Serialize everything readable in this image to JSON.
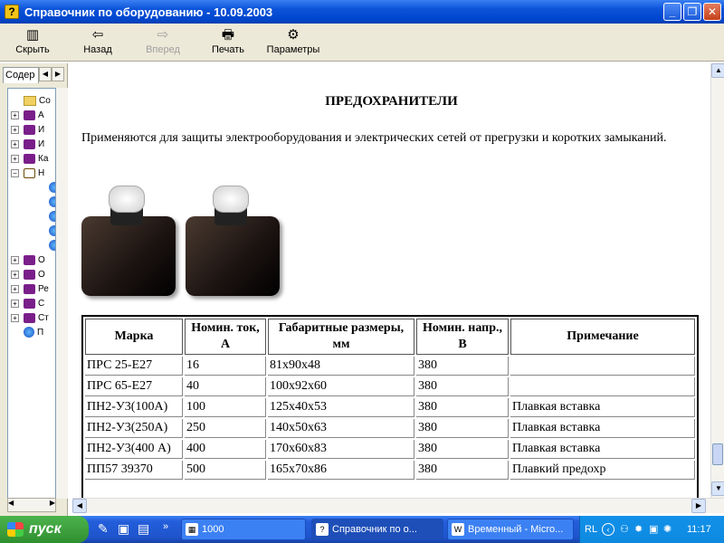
{
  "window": {
    "title": "Справочник по оборудованию - 10.09.2003",
    "app_icon": "?",
    "btn_min": "_",
    "btn_max": "❐",
    "btn_close": "✕"
  },
  "toolbar": {
    "hide": {
      "label": "Скрыть",
      "icon": "▥"
    },
    "back": {
      "label": "Назад",
      "icon": "⇦"
    },
    "forward": {
      "label": "Вперед",
      "icon": "⇨"
    },
    "print": {
      "label": "Печать",
      "icon": "🖶"
    },
    "options": {
      "label": "Параметры",
      "icon": "⚙"
    }
  },
  "sidebar": {
    "tab_label": "Содер",
    "items": [
      {
        "label": "Со",
        "icon": "folder-icon",
        "expander": "",
        "top": 0
      },
      {
        "label": "А",
        "icon": "book-icon",
        "expander": "+"
      },
      {
        "label": "И",
        "icon": "book-icon",
        "expander": "+"
      },
      {
        "label": "И",
        "icon": "book-icon",
        "expander": "+"
      },
      {
        "label": "Ка",
        "icon": "book-icon",
        "expander": "+"
      },
      {
        "label": "Н",
        "icon": "open-book-icon",
        "expander": "−"
      },
      {
        "label": "",
        "icon": "page-icon",
        "expander": ""
      },
      {
        "label": "",
        "icon": "page-icon",
        "expander": ""
      },
      {
        "label": "",
        "icon": "page-icon",
        "expander": ""
      },
      {
        "label": "",
        "icon": "page-icon",
        "expander": ""
      },
      {
        "label": "",
        "icon": "page-icon",
        "expander": ""
      },
      {
        "label": "О",
        "icon": "book-icon",
        "expander": "+"
      },
      {
        "label": "О",
        "icon": "book-icon",
        "expander": "+"
      },
      {
        "label": "Ре",
        "icon": "book-icon",
        "expander": "+"
      },
      {
        "label": "С",
        "icon": "book-icon",
        "expander": "+"
      },
      {
        "label": "Ст",
        "icon": "book-icon",
        "expander": "+"
      },
      {
        "label": "П",
        "icon": "page-icon",
        "expander": ""
      }
    ]
  },
  "content": {
    "heading": "ПРЕДОХРАНИТЕЛИ",
    "description": "Применяются для защиты электрооборудования и электрических сетей от прегрузки и коротких замыканий.",
    "table": {
      "headers": [
        "Марка",
        "Номин. ток, А",
        "Габаритные размеры, мм",
        "Номин. напр., В",
        "Примечание"
      ],
      "rows": [
        [
          "ПРС 25-Е27",
          "16",
          "81х90х48",
          "380",
          ""
        ],
        [
          "ПРС 65-Е27",
          "40",
          "100х92х60",
          "380",
          ""
        ],
        [
          "ПН2-У3(100А)",
          "100",
          "125х40х53",
          "380",
          "Плавкая вставка"
        ],
        [
          "ПН2-У3(250А)",
          "250",
          "140х50х63",
          "380",
          "Плавкая вставка"
        ],
        [
          "ПН2-У3(400 А)",
          "400",
          "170х60х83",
          "380",
          "Плавкая вставка"
        ],
        [
          "ПП57 39370",
          "500",
          "165х70х86",
          "380",
          "Плавкий предохр"
        ]
      ]
    }
  },
  "taskbar": {
    "start_label": "пуск",
    "tasks": [
      {
        "label": "1000",
        "icon": "▦"
      },
      {
        "label": "Справочник по о...",
        "icon": "?"
      },
      {
        "label": "Временный - Micro...",
        "icon": "W"
      }
    ],
    "tray": {
      "lang": "RL",
      "time": "11:17"
    }
  }
}
